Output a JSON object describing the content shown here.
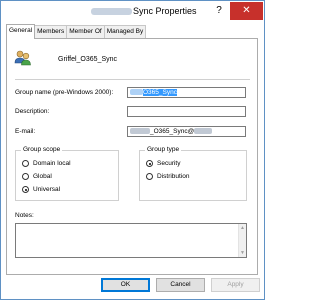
{
  "window": {
    "title": "Sync Properties",
    "help_glyph": "?",
    "close_glyph": "✕"
  },
  "tabs": [
    {
      "label": "General"
    },
    {
      "label": "Members"
    },
    {
      "label": "Member Of"
    },
    {
      "label": "Managed By"
    }
  ],
  "general": {
    "group_name": "Griffel_O365_Sync",
    "pre2000_label": "Group name (pre-Windows 2000):",
    "pre2000_value": "O365_Sync",
    "description_label": "Description:",
    "description_value": "",
    "email_label": "E-mail:",
    "email_value": "_O365_Sync@"
  },
  "scope": {
    "legend": "Group scope",
    "options": [
      {
        "label": "Domain local",
        "selected": false
      },
      {
        "label": "Global",
        "selected": false
      },
      {
        "label": "Universal",
        "selected": true
      }
    ]
  },
  "type": {
    "legend": "Group type",
    "options": [
      {
        "label": "Security",
        "selected": true
      },
      {
        "label": "Distribution",
        "selected": false
      }
    ]
  },
  "notes": {
    "label": "Notes:",
    "value": ""
  },
  "buttons": {
    "ok": "OK",
    "cancel": "Cancel",
    "apply": "Apply"
  },
  "icons": {
    "group": "group-icon",
    "help": "help-icon",
    "close": "close-icon"
  },
  "colors": {
    "window_border": "#5f91c4",
    "close_button": "#c7302b",
    "selection": "#3399ff",
    "default_button_border": "#0078d7"
  }
}
